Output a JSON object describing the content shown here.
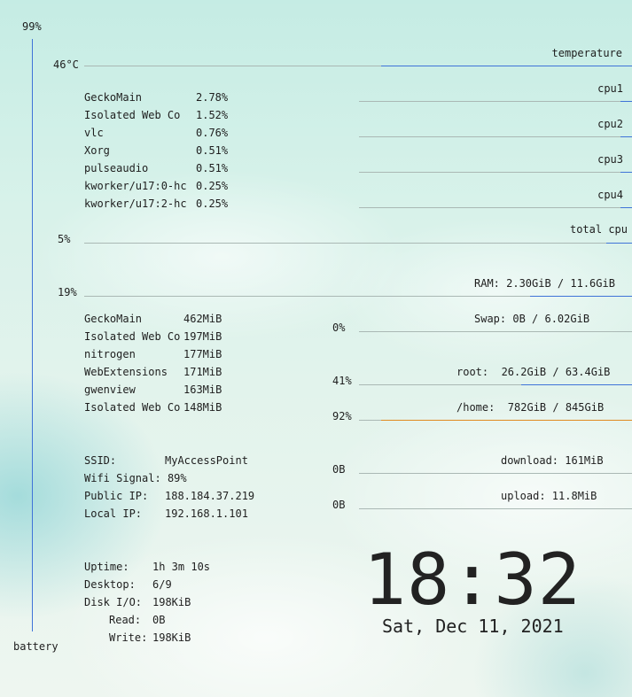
{
  "battery": {
    "percent_text": "99%",
    "label": "battery",
    "level": 0.99
  },
  "temperature": {
    "value": "46°C",
    "label": "temperature",
    "level": 0.46
  },
  "cpu": {
    "labels": [
      "cpu1",
      "cpu2",
      "cpu3",
      "cpu4"
    ],
    "levels": [
      0.03,
      0.03,
      0.03,
      0.03
    ],
    "total_label": "total cpu",
    "total_value": "5%",
    "total_level": 0.05
  },
  "cpu_processes": [
    {
      "name": "GeckoMain",
      "value": "2.78%"
    },
    {
      "name": "Isolated Web Co",
      "value": "1.52%"
    },
    {
      "name": "vlc",
      "value": "0.76%"
    },
    {
      "name": "Xorg",
      "value": "0.51%"
    },
    {
      "name": "pulseaudio",
      "value": "0.51%"
    },
    {
      "name": "kworker/u17:0-hc",
      "value": "0.25%"
    },
    {
      "name": "kworker/u17:2-hc",
      "value": "0.25%"
    }
  ],
  "memory": {
    "ram_percent": "19%",
    "ram_label": "RAM: 2.30GiB / 11.6GiB",
    "ram_level": 0.19,
    "swap_percent": "0%",
    "swap_label": "Swap: 0B / 6.02GiB",
    "swap_level": 0.0
  },
  "mem_processes": [
    {
      "name": "GeckoMain",
      "value": "462MiB"
    },
    {
      "name": "Isolated Web Co",
      "value": "197MiB"
    },
    {
      "name": "nitrogen",
      "value": "177MiB"
    },
    {
      "name": "WebExtensions",
      "value": "171MiB"
    },
    {
      "name": "gwenview",
      "value": "163MiB"
    },
    {
      "name": "Isolated Web Co",
      "value": "148MiB"
    }
  ],
  "disks": {
    "root_percent": "41%",
    "root_label": "root:  26.2GiB / 63.4GiB",
    "root_level": 0.41,
    "home_percent": "92%",
    "home_label": "/home:  782GiB / 845GiB",
    "home_level": 0.92
  },
  "network": {
    "download_value": "0B",
    "download_label": "download: 161MiB",
    "upload_value": "0B",
    "upload_label": "upload: 11.8MiB",
    "ssid_label": "SSID:",
    "ssid": "MyAccessPoint",
    "signal_label": "Wifi Signal:",
    "signal": "89%",
    "public_ip_label": "Public IP:",
    "public_ip": "188.184.37.219",
    "local_ip_label": "Local IP:",
    "local_ip": "192.168.1.101"
  },
  "system": {
    "uptime_label": "Uptime:",
    "uptime": "1h 3m 10s",
    "desktop_label": "Desktop:",
    "desktop": "6/9",
    "diskio_label": "Disk I/O:",
    "diskio": "198KiB",
    "read_label": "Read:",
    "read": "0B",
    "write_label": "Write:",
    "write": "198KiB"
  },
  "clock": {
    "time": "18:32",
    "date": "Sat, Dec 11, 2021"
  },
  "colors": {
    "bar": "#3f73d8",
    "warning": "#e08a20",
    "track": "#aab8b4"
  }
}
